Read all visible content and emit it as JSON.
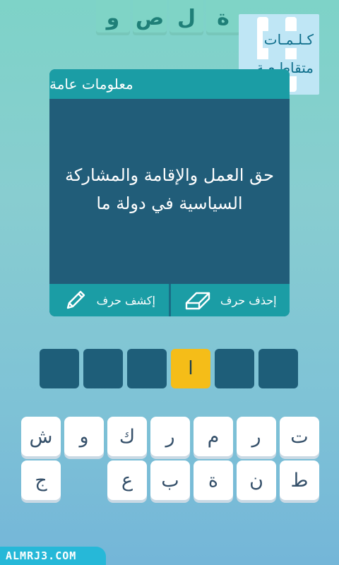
{
  "title_tiles": [
    "و",
    "ص",
    "ل",
    "ة"
  ],
  "logo": {
    "line1": "كـلـمـات",
    "line2": "متقاطـعـة"
  },
  "card": {
    "category": "معلومات عامة",
    "question": "حق العمل والإقامة والمشاركة السياسية في دولة ما",
    "help": {
      "remove_label": "إحذف حرف",
      "reveal_label": "إكشف حرف"
    }
  },
  "answer_slots": [
    "",
    "",
    "",
    "ا",
    "",
    ""
  ],
  "revealed_index": 3,
  "keyboard": {
    "row1": [
      "ت",
      "ر",
      "م",
      "ر",
      "ك",
      "و",
      "ش"
    ],
    "row2": [
      "ط",
      "ن",
      "ة",
      "ب",
      "ع",
      "",
      "ج"
    ]
  },
  "watermark": "ALMRJ3.COM",
  "colors": {
    "card_header": "#1b9da5",
    "card_body": "#215d79",
    "slot": "#1e5e79",
    "revealed": "#f5bd18"
  }
}
